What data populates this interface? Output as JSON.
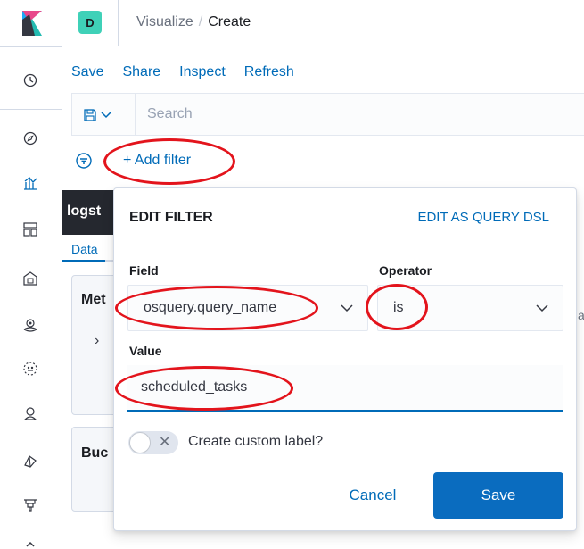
{
  "header": {
    "space_initial": "D",
    "breadcrumb_parent": "Visualize",
    "breadcrumb_separator": "/",
    "breadcrumb_current": "Create"
  },
  "nav_icons": [
    "clock-icon",
    "compass-icon",
    "visualize-icon",
    "dashboard-icon",
    "canvas-icon",
    "maps-icon",
    "ml-icon",
    "infra-icon",
    "apm-icon",
    "uptime-icon",
    "more-icon"
  ],
  "top_menu": [
    "Save",
    "Share",
    "Inspect",
    "Refresh"
  ],
  "search": {
    "placeholder": "Search"
  },
  "filter_bar": {
    "add_filter_label": "+ Add filter"
  },
  "background": {
    "title_fragment": "logst",
    "tab_data": "Data",
    "panel_metrics_fragment": "Met",
    "panel_buckets_fragment": "Buc",
    "chevron": "›",
    "right_fragment": "a"
  },
  "edit_filter": {
    "title": "EDIT FILTER",
    "query_dsl_link": "EDIT AS QUERY DSL",
    "field_label": "Field",
    "field_value": "osquery.query_name",
    "operator_label": "Operator",
    "operator_value": "is",
    "value_label": "Value",
    "value_value": "scheduled_tasks",
    "custom_label_toggle": "Create custom label?",
    "toggle_x": "✕",
    "cancel_label": "Cancel",
    "save_label": "Save"
  },
  "colors": {
    "link": "#006bb8",
    "primary_button": "#0a6cbf",
    "annotation_red": "#e3141c",
    "space_badge": "#3fd1b8"
  }
}
